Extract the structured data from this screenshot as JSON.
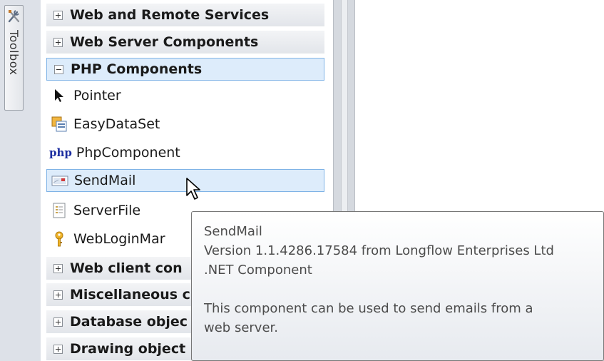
{
  "toolbox_tab": {
    "label": "Toolbox",
    "icon": "toolbox-tools-icon"
  },
  "categories_top": [
    {
      "label": "Web and Remote Services",
      "expander": "+"
    },
    {
      "label": "Web Server Components",
      "expander": "+"
    }
  ],
  "open_category": {
    "label": "PHP Components",
    "expander": "-"
  },
  "items": [
    {
      "label": "Pointer",
      "icon": "pointer-arrow-icon"
    },
    {
      "label": "EasyDataSet",
      "icon": "dataset-icon"
    },
    {
      "label": "PhpComponent",
      "icon": "php-icon",
      "icon_text": "php"
    },
    {
      "label": "SendMail",
      "icon": "mail-icon",
      "selected": true
    },
    {
      "label": "ServerFile",
      "icon": "file-icon"
    },
    {
      "label": "WebLoginMar",
      "icon": "key-icon"
    }
  ],
  "categories_bottom": [
    {
      "label": "Web client con",
      "expander": "+"
    },
    {
      "label": "Miscellaneous c",
      "expander": "+"
    },
    {
      "label": "Database objec",
      "expander": "+"
    },
    {
      "label": "Drawing object",
      "expander": "+"
    }
  ],
  "tooltip": {
    "title": "SendMail",
    "version": "Version 1.1.4286.17584 from Longflow Enterprises Ltd",
    "type": ".NET Component",
    "description_line1": "This component can be used to send emails from a",
    "description_line2": "web server."
  },
  "colors": {
    "selection_bg": "#ddecfb",
    "selection_border": "#7fb3e6",
    "php_icon": "#1c2da0"
  }
}
